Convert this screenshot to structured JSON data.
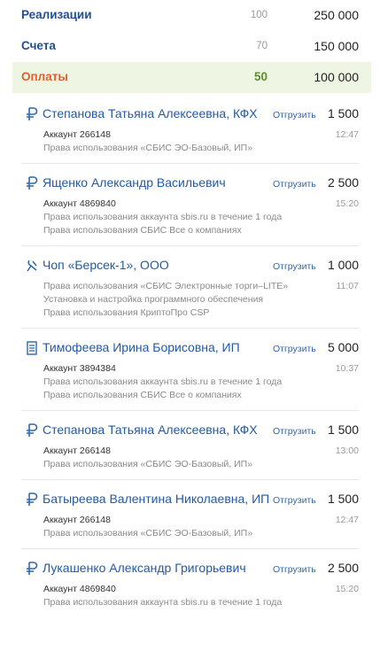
{
  "summary": [
    {
      "label": "Реализации",
      "count": "100",
      "amount": "250 000",
      "active": false
    },
    {
      "label": "Счета",
      "count": "70",
      "amount": "150 000",
      "active": false
    },
    {
      "label": "Оплаты",
      "count": "50",
      "amount": "100 000",
      "active": true
    }
  ],
  "colors": {
    "accent_blue": "#215aa6",
    "payments_orange": "#e2612a",
    "active_green": "#5f8c30",
    "active_bg": "#eef5e3"
  },
  "items": [
    {
      "icon": "ruble-icon",
      "name": "Степанова Татьяна Алексеевна, КФХ",
      "action": "Отгрузить",
      "amount": "1 500",
      "account": "Аккаунт 266148",
      "time": "12:47",
      "lines": [
        "Права использования «СБИС ЭО-Базовый, ИП»"
      ]
    },
    {
      "icon": "ruble-icon",
      "name": "Ященко Александр Васильевич",
      "action": "Отгрузить",
      "amount": "2 500",
      "account": "Аккаунт 4869840",
      "time": "15:20",
      "lines": [
        "Права использования аккаунта sbis.ru в течение 1 года",
        "Права использования СБИС Все о компаниях"
      ]
    },
    {
      "icon": "card-icon",
      "name": "Чоп «Берсек-1», ООО",
      "action": "Отгрузить",
      "amount": "1 000",
      "account": "",
      "time": "11:07",
      "lines": [
        "Права использования «СБИС Электронные торги–LITE»",
        "Установка и настройка программного обеспечения",
        "Права использования КриптоПро CSP"
      ]
    },
    {
      "icon": "document-icon",
      "name": "Тимофеева Ирина Борисовна, ИП",
      "action": "Отгрузить",
      "amount": "5 000",
      "account": "Аккаунт 3894384",
      "time": "10:37",
      "lines": [
        "Права использования аккаунта sbis.ru в течение 1 года",
        "Права использования СБИС Все о компаниях"
      ]
    },
    {
      "icon": "ruble-icon",
      "name": "Степанова Татьяна Алексеевна, КФХ",
      "action": "Отгрузить",
      "amount": "1 500",
      "account": "Аккаунт 266148",
      "time": "13:00",
      "lines": [
        "Права использования «СБИС ЭО-Базовый, ИП»"
      ]
    },
    {
      "icon": "ruble-icon",
      "name": "Батыреева Валентина Николаевна, ИП",
      "action": "Отгрузить",
      "amount": "1 500",
      "account": "Аккаунт 266148",
      "time": "12:47",
      "lines": [
        "Права использования «СБИС ЭО-Базовый, ИП»"
      ]
    },
    {
      "icon": "ruble-icon",
      "name": "Лукашенко Александр Григорьевич",
      "action": "Отгрузить",
      "amount": "2 500",
      "account": "Аккаунт 4869840",
      "time": "15:20",
      "lines": [
        "Права использования аккаунта sbis.ru в течение 1 года"
      ]
    }
  ]
}
